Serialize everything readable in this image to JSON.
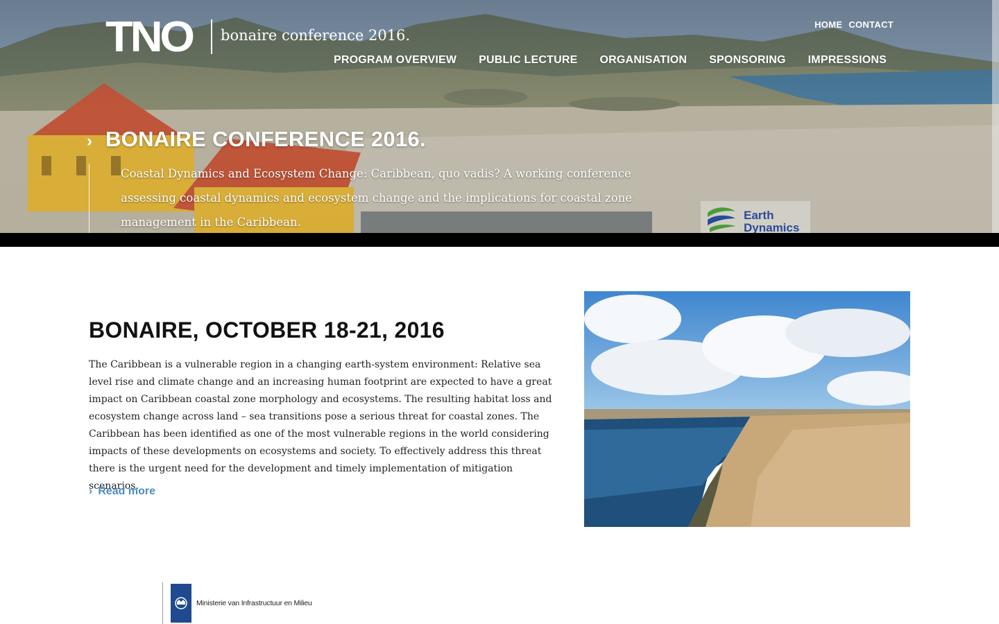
{
  "header": {
    "logo_text": "TNO",
    "logo_subtitle": "bonaire conference 2016.",
    "top_links": [
      "HOME",
      "CONTACT"
    ],
    "nav": [
      "PROGRAM OVERVIEW",
      "PUBLIC LECTURE",
      "ORGANISATION",
      "SPONSORING",
      "IMPRESSIONS"
    ]
  },
  "hero": {
    "chevron": "›",
    "title": "BONAIRE CONFERENCE 2016.",
    "description": "Coastal Dynamics and Ecosystem Change: Caribbean, quo vadis? A working conference assessing coastal dynamics and ecosystem change and the implications for coastal zone management in the Caribbean.",
    "sponsor_badge": [
      "Earth",
      "Dynamics"
    ]
  },
  "main": {
    "title": "BONAIRE, OCTOBER 18-21, 2016",
    "intro": "The Caribbean is a vulnerable region in a changing earth-system environment: Relative sea level rise and climate change and an increasing human footprint are expected to have a great impact on Caribbean coastal zone morphology and ecosystems. The resulting habitat loss and ecosystem change across land – sea transitions pose a serious threat for coastal zones. The Caribbean has been identified as one of the most vulnerable regions in the world considering impacts of these developments on ecosystems and society. To effectively address this threat there is the urgent need for the development and timely implementation of mitigation scenarios.",
    "read_more": "Read more",
    "read_more_chevron": "›"
  },
  "footer": {
    "ministry_name": "Ministerie van Infrastructuur en Milieu"
  },
  "colors": {
    "link_blue": "#4a8fc4",
    "ministry_blue": "#1f4a8f",
    "roof_orange": "#c8583a",
    "wall_yellow": "#e3b63a"
  }
}
